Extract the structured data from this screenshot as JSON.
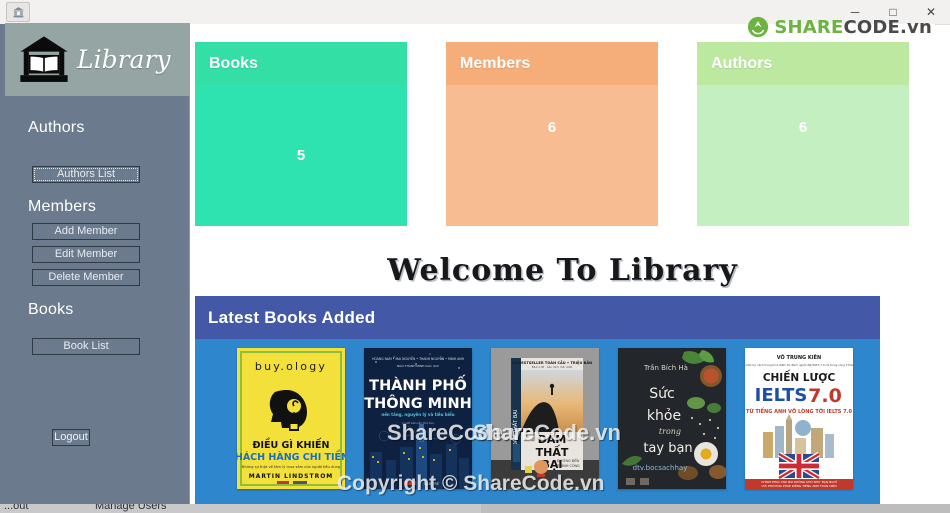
{
  "window": {
    "app_icon": "library-app-icon",
    "controls": [
      {
        "name": "minimize",
        "glyph": "─"
      },
      {
        "name": "maximize",
        "glyph": "□"
      },
      {
        "name": "close",
        "glyph": "✕"
      }
    ]
  },
  "logo": {
    "mark": "sharecode-recycle-logo",
    "part1": "SHARE",
    "part2": "CODE.vn"
  },
  "sidebar": {
    "brand": {
      "icon": "library-building-icon",
      "title": "Library"
    },
    "sections": [
      {
        "heading": "Authors",
        "buttons": [
          {
            "label": "Authors List",
            "name": "authors-list-button",
            "focused": true
          }
        ]
      },
      {
        "heading": "Members",
        "buttons": [
          {
            "label": "Add Member",
            "name": "add-member-button",
            "focused": false
          },
          {
            "label": "Edit Member",
            "name": "edit-member-button",
            "focused": false
          },
          {
            "label": "Delete Member",
            "name": "delete-member-button",
            "focused": false
          }
        ]
      },
      {
        "heading": "Books",
        "buttons": [
          {
            "label": "Book List",
            "name": "book-list-button",
            "focused": false
          }
        ]
      }
    ],
    "logout_label": "Logout"
  },
  "cards": [
    {
      "name": "books",
      "title": "Books",
      "value": "5",
      "head_color": "#34dfa6",
      "body_color": "#2fe3b0"
    },
    {
      "name": "members",
      "title": "Members",
      "value": "6",
      "head_color": "#f5ad79",
      "body_color": "#f8bc92"
    },
    {
      "name": "authors",
      "title": "Authors",
      "value": "6",
      "head_color": "#bce8a0",
      "body_color": "#c4efc1"
    }
  ],
  "welcome": {
    "text": "Welcome To Library"
  },
  "books_panel": {
    "title": "Latest Books Added",
    "header_color": "#4359a8",
    "body_color": "#2e86cc",
    "books": [
      {
        "name": "book-cover-buyology",
        "title": "buy.ology",
        "subtitle": "ĐIỀU GÌ KHIẾN KHÁCH HÀNG CHI TIẾN?",
        "author": "MARTIN LINDSTROM"
      },
      {
        "name": "book-cover-thanh-pho",
        "title": "THÀNH PHỐ THÔNG MINH",
        "subtitle": "",
        "author": ""
      },
      {
        "name": "book-cover-dam-that-bai",
        "title": "DÁM THẤT BẠI",
        "subtitle": "",
        "author": ""
      },
      {
        "name": "book-cover-suc-khoe",
        "title": "SỨC KHỎ E trong tay bạn",
        "subtitle": "",
        "author": "Trần Bích Hà"
      },
      {
        "name": "book-cover-ielts",
        "title": "CHIẾN LƯỢC IELTS 7.0",
        "subtitle": "TỪ TIẾNG ANH VỠ LÒNG TỚI IELTS 7.0",
        "author": "VÕ TRUNG KIÊN"
      }
    ]
  },
  "watermarks": {
    "books_a": "ShareCode.vn",
    "books_b": "ShareCode.vn",
    "copyright": "Copyright © ShareCode.vn"
  },
  "bottom_strip": {
    "left_item": "...out",
    "right_item": "Manage Users"
  }
}
